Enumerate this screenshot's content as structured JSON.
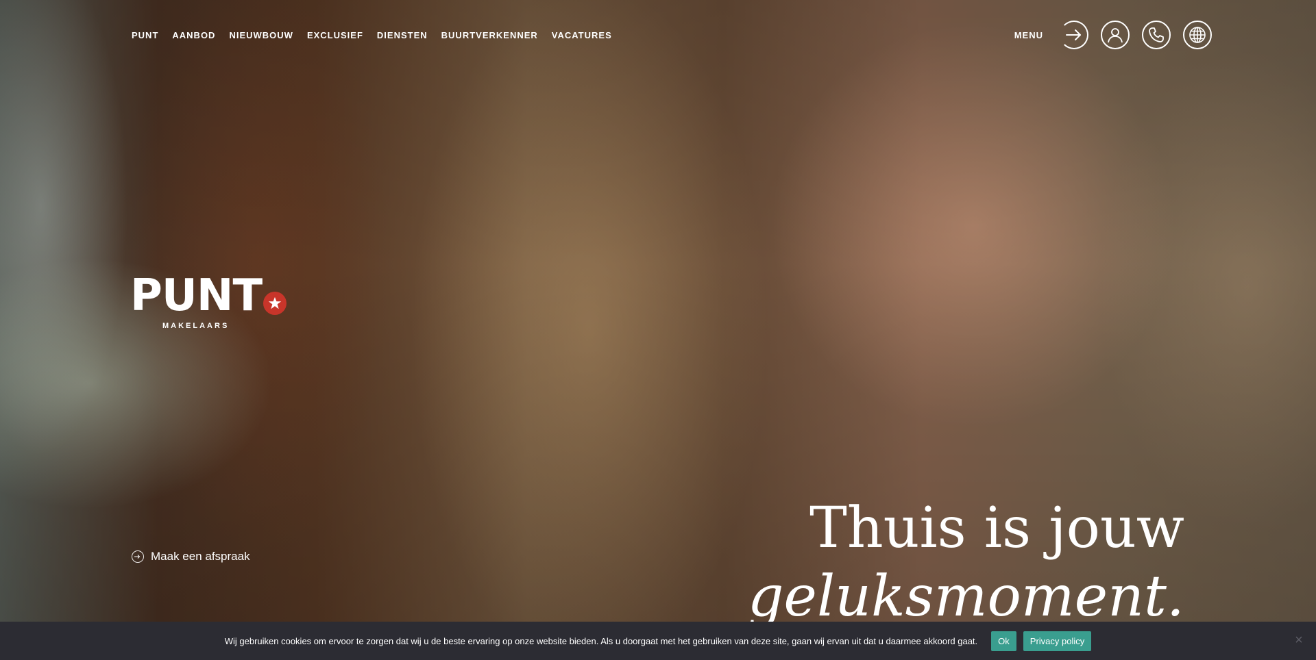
{
  "nav": {
    "items": [
      {
        "label": "PUNT"
      },
      {
        "label": "AANBOD"
      },
      {
        "label": "NIEUWBOUW"
      },
      {
        "label": "EXCLUSIEF"
      },
      {
        "label": "DIENSTEN"
      },
      {
        "label": "BUURTVERKENNER"
      },
      {
        "label": "VACATURES"
      }
    ],
    "menu_label": "MENU",
    "icons": [
      "arrow-right-icon",
      "user-icon",
      "phone-icon",
      "globe-icon"
    ]
  },
  "logo": {
    "text": "PUNT",
    "subtitle": "MAKELAARS",
    "star_color": "#c8352a"
  },
  "appointment": {
    "label": "Maak een afspraak"
  },
  "headline": {
    "line1": "Thuis is jouw",
    "line2": "geluksmoment."
  },
  "cookie": {
    "message": "Wij gebruiken cookies om ervoor te zorgen dat wij u de beste ervaring op onze website bieden. Als u doorgaat met het gebruiken van deze site, gaan wij ervan uit dat u daarmee akkoord gaat.",
    "ok_label": "Ok",
    "privacy_label": "Privacy policy",
    "close_label": "×",
    "button_color": "#3a9e8f",
    "bar_color": "#2c2c33"
  }
}
